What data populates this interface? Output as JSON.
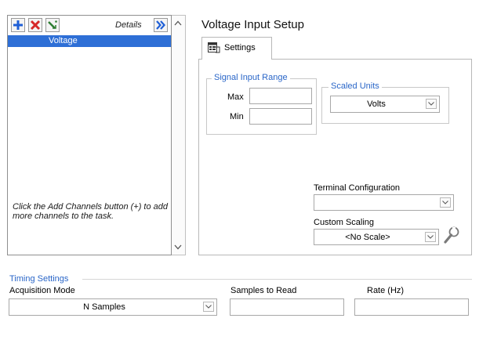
{
  "channels_panel": {
    "details_label": "Details",
    "channels": [
      "Voltage"
    ],
    "hint": "Click the Add Channels button (+) to add more channels to the task."
  },
  "setup": {
    "title": "Voltage Input Setup",
    "tab_label": "Settings",
    "signal_input_range": {
      "title": "Signal Input Range",
      "max_label": "Max",
      "max_value": "",
      "min_label": "Min",
      "min_value": ""
    },
    "scaled_units": {
      "title": "Scaled Units",
      "value": "Volts"
    },
    "terminal_configuration": {
      "label": "Terminal Configuration",
      "value": ""
    },
    "custom_scaling": {
      "label": "Custom Scaling",
      "value": "<No Scale>"
    }
  },
  "timing": {
    "title": "Timing Settings",
    "acquisition_mode_label": "Acquisition Mode",
    "acquisition_mode_value": "N Samples",
    "samples_to_read_label": "Samples to Read",
    "samples_to_read_value": "",
    "rate_label": "Rate (Hz)",
    "rate_value": ""
  },
  "colors": {
    "selection": "#2e6fd6",
    "group_title": "#2a66c8",
    "add_icon": "#1f5fd6",
    "remove_icon": "#d62828"
  },
  "icons": [
    "add-icon",
    "remove-icon",
    "configure-icon",
    "double-chevron-right-icon",
    "scroll-up-icon",
    "scroll-down-icon",
    "settings-tab-icon",
    "chevron-down-icon",
    "wrench-icon"
  ]
}
